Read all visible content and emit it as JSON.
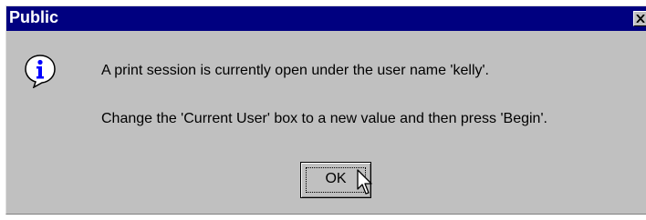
{
  "window": {
    "title": "Public",
    "close_icon": "close-x-icon"
  },
  "message": {
    "icon": "information-icon",
    "line1": "A print session is currently open under the user name 'kelly'.",
    "line2": "Change the 'Current User' box to a new value and then press 'Begin'."
  },
  "buttons": {
    "ok_label": "OK"
  },
  "colors": {
    "titlebar": "#000080",
    "dialog_bg": "#c0c0c0",
    "icon_blue": "#0000ff"
  }
}
